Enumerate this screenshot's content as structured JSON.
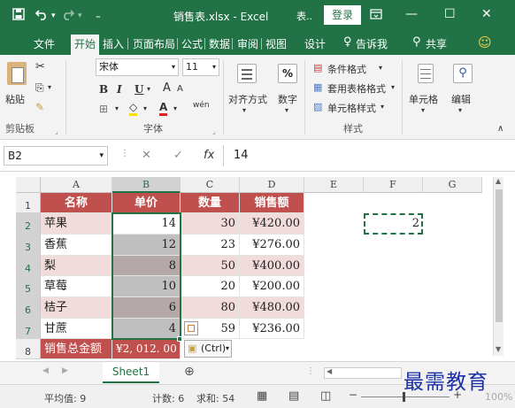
{
  "titlebar": {
    "save_icon": "save-icon",
    "undo_icon": "undo-icon",
    "redo_icon": "redo-icon",
    "customize_icon": "customize-icon",
    "title": "销售表.xlsx - Excel",
    "short": "表..",
    "login": "登录",
    "ribbon_display_icon": "ribbon-display-icon",
    "minimize": "—",
    "restore": "☐",
    "close": "✕"
  },
  "menu": {
    "file": "文件",
    "home": "开始",
    "insert": "插入",
    "page_layout": "页面布局",
    "formulas": "公式",
    "data": "数据",
    "review": "审阅",
    "view": "视图",
    "design": "设计",
    "tell_me": "告诉我",
    "share": "共享",
    "smiley": "☺"
  },
  "ribbon": {
    "paste": "粘贴",
    "clipboard": "剪贴板",
    "font_name": "宋体",
    "font_size": "11",
    "bold": "B",
    "italic": "I",
    "underline": "U",
    "grow": "A",
    "shrink": "A",
    "font_color": "A",
    "phonetic": "wén",
    "font_group": "字体",
    "align": "对齐方式",
    "number": "数字",
    "percent": "%",
    "cond_format": "条件格式",
    "table_format": "套用表格格式",
    "cell_style": "单元格样式",
    "style_group": "样式",
    "cells": "单元格",
    "edit": "编辑"
  },
  "formula_bar": {
    "name_box": "B2",
    "cancel": "✕",
    "enter": "✓",
    "fx": "fx",
    "value": "14"
  },
  "grid": {
    "columns": [
      "A",
      "B",
      "C",
      "D",
      "E",
      "F",
      "G"
    ],
    "rows": [
      "1",
      "2",
      "3",
      "4",
      "5",
      "6",
      "7",
      "8"
    ],
    "headers": [
      "名称",
      "单价",
      "数量",
      "销售额"
    ],
    "data": [
      [
        "苹果",
        "14",
        "30",
        "¥420.00"
      ],
      [
        "香蕉",
        "12",
        "23",
        "¥276.00"
      ],
      [
        "梨",
        "8",
        "50",
        "¥400.00"
      ],
      [
        "草莓",
        "10",
        "20",
        "¥200.00"
      ],
      [
        "桔子",
        "6",
        "80",
        "¥480.00"
      ],
      [
        "甘蔗",
        "4",
        "59",
        "¥236.00"
      ]
    ],
    "total_label": "销售总金额",
    "total_value": "¥2, 012. 00",
    "f2_value": "2",
    "paste_options": "(Ctrl)"
  },
  "sheets": {
    "tab": "Sheet1",
    "add": "⊕"
  },
  "status": {
    "average": "平均值: 9",
    "count": "计数: 6",
    "sum": "求和: 54",
    "zoom": "100%"
  },
  "watermark": "最需教育"
}
